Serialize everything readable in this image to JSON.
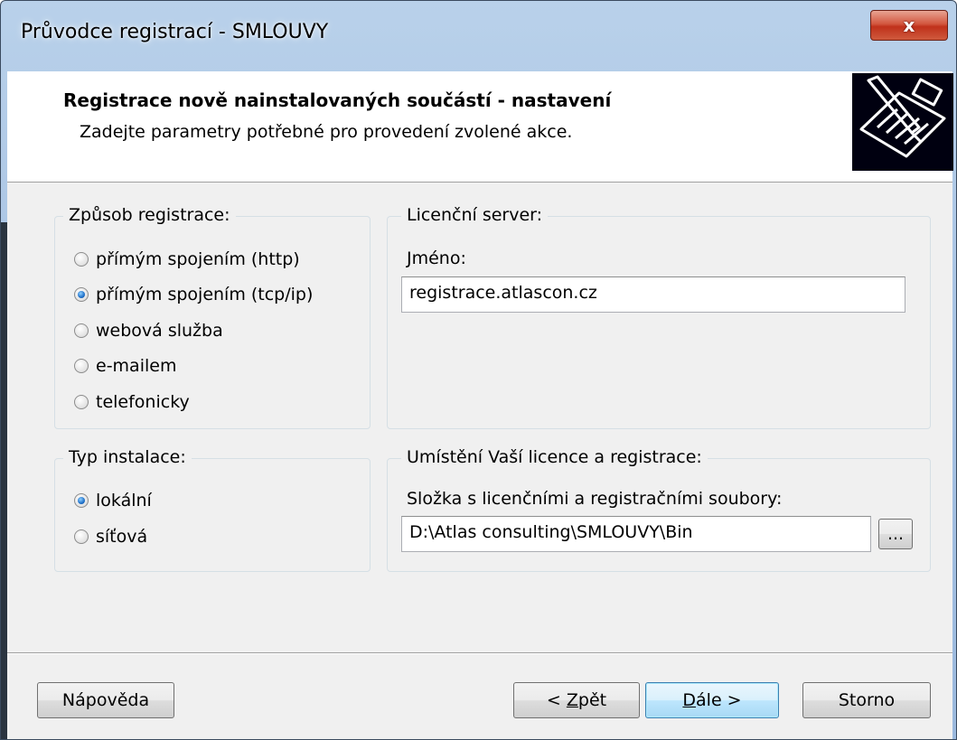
{
  "window": {
    "title": "Průvodce registrací - SMLOUVY",
    "close_label": "x"
  },
  "header": {
    "title": "Registrace nově nainstalovaných součástí - nastavení",
    "subtitle": "Zadejte parametry potřebné pro provedení zvolené akce.",
    "icon": "wizard-document-pen-icon"
  },
  "registration_method": {
    "title": "Způsob registrace:",
    "options": [
      {
        "label": "přímým spojením (http)",
        "checked": false
      },
      {
        "label": "přímým spojením (tcp/ip)",
        "checked": true
      },
      {
        "label": "webová služba",
        "checked": false
      },
      {
        "label": "e-mailem",
        "checked": false
      },
      {
        "label": "telefonicky",
        "checked": false
      }
    ]
  },
  "license_server": {
    "title": "Licenční server:",
    "name_label": "Jméno:",
    "name_value": "registrace.atlascon.cz"
  },
  "install_type": {
    "title": "Typ instalace:",
    "options": [
      {
        "label": "lokální",
        "checked": true
      },
      {
        "label": "síťová",
        "checked": false
      }
    ]
  },
  "license_location": {
    "title": "Umístění Vaší licence a registrace:",
    "folder_label": "Složka s licenčními a registračními soubory:",
    "folder_value": "D:\\Atlas consulting\\SMLOUVY\\Bin",
    "browse_label": "..."
  },
  "buttons": {
    "help": "Nápověda",
    "back_prefix": "< ",
    "back_mnemonic": "Z",
    "back_rest": "pět",
    "next_mnemonic": "D",
    "next_rest": "ále >",
    "cancel": "Storno"
  },
  "colors": {
    "titlebar": "#b9d1ea",
    "close_button": "#c0311b",
    "default_button_border": "#3c7fb1",
    "radio_checked": "#1e6fc8"
  }
}
